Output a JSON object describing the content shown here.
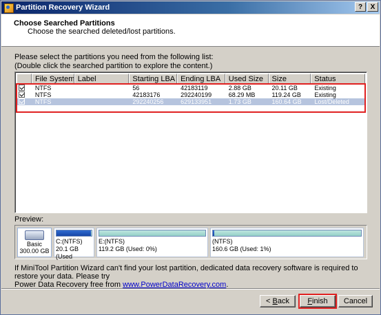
{
  "window": {
    "title": "Partition Recovery Wizard",
    "help_label": "?",
    "close_label": "X"
  },
  "header": {
    "title": "Choose Searched Partitions",
    "subtitle": "Choose the searched deleted/lost partitions."
  },
  "instructions": {
    "line1": "Please select the partitions you need from the following list:",
    "line2": "(Double click the searched partition to explore the content.)"
  },
  "table": {
    "columns": [
      "File System",
      "Label",
      "Starting LBA",
      "Ending LBA",
      "Used Size",
      "Size",
      "Status"
    ],
    "rows": [
      {
        "checked": true,
        "fs": "NTFS",
        "label": "",
        "start": "56",
        "end": "42183119",
        "used": "2.88 GB",
        "size": "20.11 GB",
        "status": "Existing",
        "selected": false
      },
      {
        "checked": true,
        "fs": "NTFS",
        "label": "",
        "start": "42183176",
        "end": "292240199",
        "used": "68.29 MB",
        "size": "119.24 GB",
        "status": "Existing",
        "selected": false
      },
      {
        "checked": true,
        "fs": "NTFS",
        "label": "",
        "start": "292240256",
        "end": "629133951",
        "used": "1.73 GB",
        "size": "160.64 GB",
        "status": "Lost/Deleted",
        "selected": true
      }
    ]
  },
  "preview": {
    "label": "Preview:",
    "disk": {
      "type": "Basic",
      "size": "300.00 GB"
    },
    "partitions": [
      {
        "name": "C:(NTFS)",
        "info": "20.1 GB (Used",
        "used_fraction": 0.98
      },
      {
        "name": "E:(NTFS)",
        "info": "119.2 GB (Used: 0%)",
        "used_fraction": 0.0
      },
      {
        "name": "(NTFS)",
        "info": "160.6 GB (Used: 1%)",
        "used_fraction": 0.01
      }
    ]
  },
  "note": {
    "text1": "If MiniTool Partition Wizard can't find your lost partition, dedicated data recovery software is required to restore your data. Please try",
    "text2": "Power Data Recovery free from ",
    "link": "www.PowerDataRecovery.com",
    "end": "."
  },
  "buttons": {
    "back": {
      "prefix": "< ",
      "hot": "B",
      "rest": "ack"
    },
    "finish": {
      "hot": "F",
      "rest": "inish"
    },
    "cancel": "Cancel"
  },
  "colors": {
    "highlight": "#e02020",
    "selected_row": "#b6c4de",
    "titlebar": "#0a246a"
  }
}
